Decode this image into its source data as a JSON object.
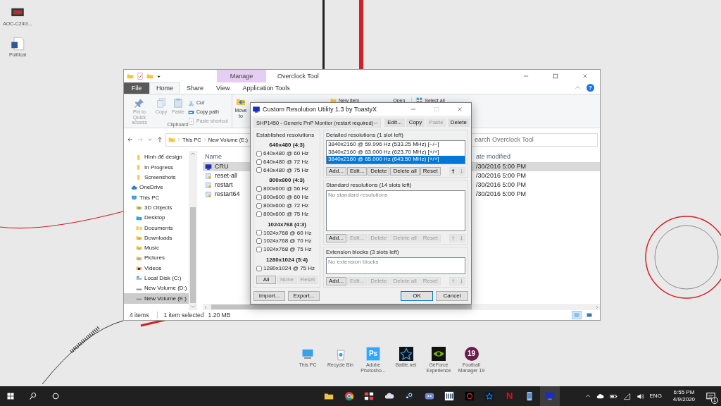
{
  "desktop_icons": [
    {
      "label": "AOC-C24G...",
      "kind": "monitor"
    },
    {
      "label": "Political",
      "kind": "word"
    }
  ],
  "bottom_icons": [
    {
      "label": "This PC",
      "kind": "pc"
    },
    {
      "label": "Recycle Bin",
      "kind": "bin"
    },
    {
      "label": "Adobe Photosho...",
      "kind": "logo",
      "glyph": "Ps",
      "color": "#31a8ff"
    },
    {
      "label": "Battle.net",
      "kind": "star"
    },
    {
      "label": "GeForce Experience",
      "kind": "eye"
    },
    {
      "label": "Football Manager 19",
      "kind": "round",
      "glyph": "19",
      "color": "#6b1d4a"
    }
  ],
  "explorer": {
    "title": "Overclock Tool",
    "context_tab": "Manage",
    "help": "?",
    "tabs": [
      {
        "label": "File",
        "kind": "menu",
        "selected": false
      },
      {
        "label": "Home",
        "kind": "tab",
        "selected": true
      },
      {
        "label": "Share",
        "kind": "tab",
        "selected": false
      },
      {
        "label": "View",
        "kind": "tab",
        "selected": false
      },
      {
        "label": "Application Tools",
        "kind": "tab",
        "selected": false
      }
    ],
    "ribbon": {
      "group_label": "Clipboard",
      "large": [
        {
          "label": "Pin to Quick access",
          "kind": "pin",
          "disabled": true
        },
        {
          "label": "Copy",
          "kind": "copy",
          "disabled": true
        },
        {
          "label": "Paste",
          "kind": "paste",
          "disabled": true
        }
      ],
      "small": [
        {
          "label": "Cut",
          "kind": "cut",
          "disabled": false
        },
        {
          "label": "Copy path",
          "kind": "copypath",
          "disabled": false
        },
        {
          "label": "Paste shortcut",
          "kind": "shortcut",
          "disabled": true
        }
      ],
      "move_to": "Move to",
      "new_item": "New item",
      "open": "Open",
      "select_all": "Select all"
    },
    "path": [
      "This PC",
      "New Volume (E:)"
    ],
    "search": {
      "placeholder": "earch Overclock Tool"
    },
    "quick_access": [
      {
        "label": "Hình để design",
        "selected": false
      },
      {
        "label": "In Progress",
        "selected": false
      },
      {
        "label": "Screenshots",
        "selected": false
      }
    ],
    "nav": [
      {
        "label": "OneDrive",
        "kind": "cloud",
        "selected": false
      },
      {
        "label": "This PC",
        "kind": "pc",
        "selected": false,
        "children": [
          {
            "label": "3D Objects",
            "kind": "folder3d",
            "selected": false
          },
          {
            "label": "Desktop",
            "kind": "desktop",
            "selected": false
          },
          {
            "label": "Documents",
            "kind": "documents",
            "selected": false
          },
          {
            "label": "Downloads",
            "kind": "downloads",
            "selected": false
          },
          {
            "label": "Music",
            "kind": "music",
            "selected": false
          },
          {
            "label": "Pictures",
            "kind": "pictures",
            "selected": false
          },
          {
            "label": "Videos",
            "kind": "videos",
            "selected": false
          },
          {
            "label": "Local Disk (C:)",
            "kind": "system",
            "selected": false
          },
          {
            "label": "New Volume (D:)",
            "kind": "drive",
            "selected": false
          },
          {
            "label": "New Volume (E:)",
            "kind": "drive",
            "selected": true
          }
        ]
      }
    ],
    "columns": [
      "Name",
      "ate modified"
    ],
    "files": [
      {
        "name": "CRU",
        "modified": "/30/2016 5:00 PM",
        "kind": "app",
        "selected": true
      },
      {
        "name": "reset-all",
        "modified": "/30/2016 5:00 PM",
        "kind": "script",
        "selected": false
      },
      {
        "name": "restart",
        "modified": "/30/2016 5:00 PM",
        "kind": "script",
        "selected": false
      },
      {
        "name": "restart64",
        "modified": "/30/2016 5:00 PM",
        "kind": "script",
        "selected": false
      }
    ],
    "status": [
      "4 items",
      "1 item selected",
      "1.20 MB"
    ],
    "views": [
      {
        "kind": "details",
        "selected": true
      },
      {
        "kind": "thumbnails",
        "selected": false
      }
    ]
  },
  "cru": {
    "title": "Custom Resolution Utility 1.3 by ToastyX",
    "monitor": "SHP1450 - Generic PnP Monitor (restart required)",
    "top_buttons": [
      {
        "label": "Edit...",
        "disabled": false
      },
      {
        "label": "Copy",
        "disabled": false
      },
      {
        "label": "Paste",
        "disabled": true
      },
      {
        "label": "Delete",
        "disabled": false
      }
    ],
    "established": {
      "heading": "Established resolutions",
      "groups": [
        {
          "title": "640x480 (4:3)",
          "items": [
            {
              "label": "640x480 @ 60 Hz",
              "checked": false
            },
            {
              "label": "640x480 @ 72 Hz",
              "checked": false
            },
            {
              "label": "640x480 @ 75 Hz",
              "checked": false
            }
          ]
        },
        {
          "title": "800x600 (4:3)",
          "items": [
            {
              "label": "800x600 @ 56 Hz",
              "checked": false
            },
            {
              "label": "800x600 @ 60 Hz",
              "checked": false
            },
            {
              "label": "800x600 @ 72 Hz",
              "checked": false
            },
            {
              "label": "800x600 @ 75 Hz",
              "checked": false
            }
          ]
        },
        {
          "title": "1024x768 (4:3)",
          "items": [
            {
              "label": "1024x768 @ 60 Hz",
              "checked": false
            },
            {
              "label": "1024x768 @ 70 Hz",
              "checked": false
            },
            {
              "label": "1024x768 @ 75 Hz",
              "checked": false
            }
          ]
        },
        {
          "title": "1280x1024 (5:4)",
          "items": [
            {
              "label": "1280x1024 @ 75 Hz",
              "checked": false
            }
          ]
        }
      ],
      "buttons": [
        {
          "label": "All",
          "disabled": false
        },
        {
          "label": "None",
          "disabled": true
        },
        {
          "label": "Reset",
          "disabled": true
        }
      ]
    },
    "sections": [
      {
        "heading": "Detailed resolutions (1 slot left)",
        "items": [
          {
            "label": "3840x2160 @ 59.996 Hz (533.25 MHz) [−/−]",
            "selected": false
          },
          {
            "label": "3840x2160 @ 63.000 Hz (623.70 MHz) [+/+]",
            "selected": false
          },
          {
            "label": "3840x2160 @ 65.000 Hz (643.50 MHz) [+/+]",
            "selected": true
          }
        ],
        "buttons": [
          {
            "label": "Add...",
            "disabled": false
          },
          {
            "label": "Edit...",
            "disabled": false
          },
          {
            "label": "Delete",
            "disabled": false
          },
          {
            "label": "Delete all",
            "disabled": false
          },
          {
            "label": "Reset",
            "disabled": false
          }
        ],
        "arrows": [
          {
            "kind": "up",
            "disabled": false
          },
          {
            "kind": "down",
            "disabled": true
          }
        ]
      },
      {
        "heading": "Standard resolutions (14 slots left)",
        "empty_text": "No standard resolutions",
        "buttons": [
          {
            "label": "Add...",
            "disabled": false
          },
          {
            "label": "Edit...",
            "disabled": true
          },
          {
            "label": "Delete",
            "disabled": true
          },
          {
            "label": "Delete all",
            "disabled": true
          },
          {
            "label": "Reset",
            "disabled": true
          }
        ],
        "arrows": [
          {
            "kind": "up",
            "disabled": true
          },
          {
            "kind": "down",
            "disabled": true
          }
        ]
      },
      {
        "heading": "Extension blocks (3 slots left)",
        "empty_text": "No extension blocks",
        "buttons": [
          {
            "label": "Add...",
            "disabled": false
          },
          {
            "label": "Edit...",
            "disabled": true
          },
          {
            "label": "Delete",
            "disabled": true
          },
          {
            "label": "Delete all",
            "disabled": true
          },
          {
            "label": "Reset",
            "disabled": true
          }
        ],
        "arrows": [
          {
            "kind": "up",
            "disabled": true
          },
          {
            "kind": "down",
            "disabled": true
          }
        ]
      }
    ],
    "footer_left": [
      {
        "label": "Import...",
        "default": false
      },
      {
        "label": "Export...",
        "default": false
      }
    ],
    "footer_right": [
      {
        "label": "OK",
        "default": true
      },
      {
        "label": "Cancel",
        "default": false
      }
    ]
  },
  "taskbar": {
    "apps": [
      {
        "kind": "folder",
        "selected": false
      },
      {
        "kind": "browser",
        "selected": false
      },
      {
        "kind": "tiles",
        "selected": false
      },
      {
        "kind": "cloud",
        "selected": false
      },
      {
        "kind": "disc",
        "selected": false
      },
      {
        "kind": "chat",
        "selected": false
      },
      {
        "kind": "bars",
        "selected": false
      },
      {
        "kind": "eye",
        "selected": false
      },
      {
        "kind": "star",
        "selected": false
      },
      {
        "kind": "letter",
        "glyph": "N",
        "selected": false
      },
      {
        "kind": "phone",
        "selected": false
      },
      {
        "kind": "monitor",
        "selected": true
      }
    ],
    "language": "ENG",
    "time": "6:55 PM",
    "date": "4/9/2020",
    "notifications": "1"
  }
}
